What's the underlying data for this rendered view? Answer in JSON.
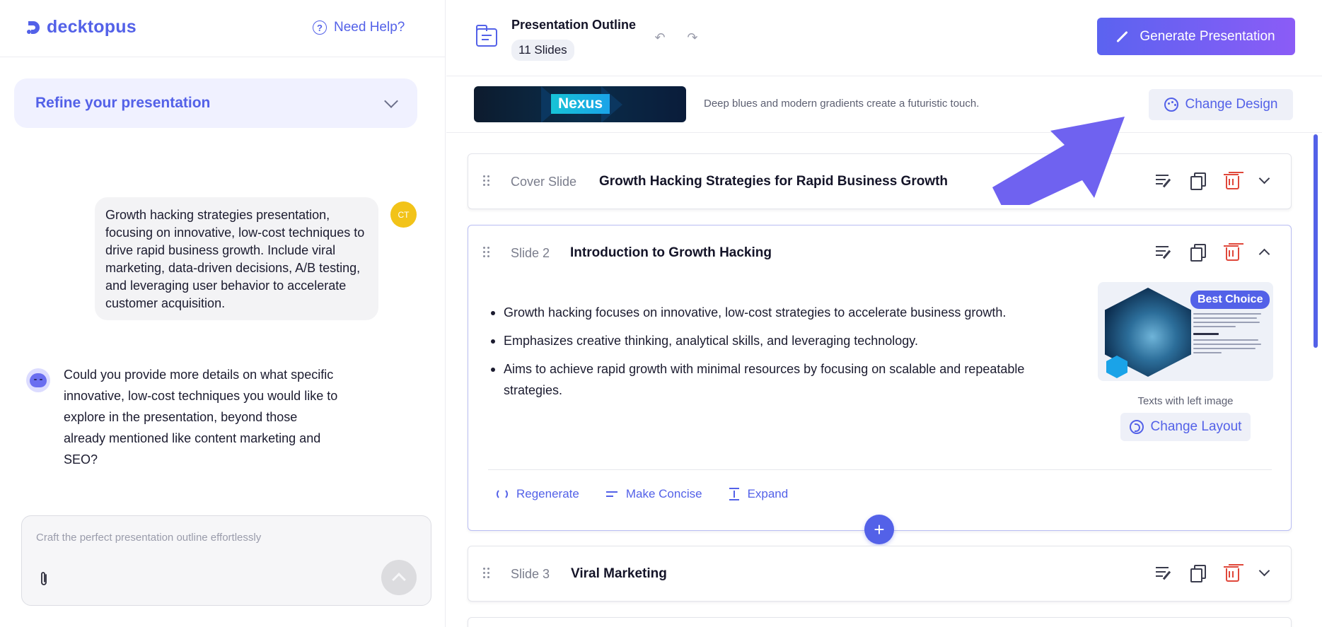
{
  "brand": {
    "name": "decktopus"
  },
  "help": {
    "label": "Need Help?"
  },
  "refine": {
    "label": "Refine your presentation"
  },
  "chat": {
    "user_initials": "CT",
    "user_message": "Growth hacking strategies presentation, focusing on innovative, low-cost techniques to drive rapid business growth. Include viral marketing, data-driven decisions, A/B testing, and leveraging user behavior to accelerate customer acquisition.",
    "bot_message": "Could you provide more details on what specific innovative, low-cost techniques you would like to explore in the presentation, beyond those already mentioned like content marketing and SEO?"
  },
  "composer": {
    "placeholder": "Craft the perfect presentation outline effortlessly",
    "value": ""
  },
  "header": {
    "title": "Presentation Outline",
    "slides_count": "11 Slides",
    "generate_label": "Generate Presentation"
  },
  "design": {
    "theme_name": "Nexus",
    "description": "Deep blues and modern gradients create a futuristic touch.",
    "change_label": "Change Design"
  },
  "slides": [
    {
      "number": "Cover Slide",
      "title": "Growth Hacking Strategies for Rapid Business Growth"
    },
    {
      "number": "Slide 2",
      "title": "Introduction to Growth Hacking",
      "bullets": [
        "Growth hacking focuses on innovative, low-cost strategies to accelerate business growth.",
        "Emphasizes creative thinking, analytical skills, and leveraging technology.",
        "Aims to achieve rapid growth with minimal resources by focusing on scalable and repeatable strategies."
      ],
      "badge": "Best Choice",
      "layout_name": "Texts with left image",
      "change_layout_label": "Change Layout",
      "actions": {
        "regenerate": "Regenerate",
        "concise": "Make Concise",
        "expand": "Expand"
      }
    },
    {
      "number": "Slide 3",
      "title": "Viral Marketing"
    }
  ],
  "colors": {
    "accent": "#5361e8",
    "danger": "#e0473a",
    "gradient_end": "#8b5cf6",
    "arrow": "#6f62f0"
  },
  "icons": {
    "logo": "decktopus-logo-icon",
    "help": "question-circle-icon",
    "refine_toggle": "chevron-down-icon",
    "outline": "folder-outline-icon",
    "undo": "undo-icon",
    "redo": "redo-icon",
    "generate": "brush-icon",
    "design": "palette-icon",
    "drag": "drag-handle-icon",
    "edit": "edit-list-icon",
    "copy": "copy-icon",
    "delete": "trash-icon",
    "collapse": "chevron-up-icon",
    "expand": "chevron-down-icon",
    "layout": "layout-swap-icon",
    "regenerate": "refresh-icon",
    "concise": "lines-icon",
    "expand_text": "expand-icon",
    "add": "plus-icon",
    "attach": "paperclip-icon",
    "send": "arrow-up-icon"
  }
}
